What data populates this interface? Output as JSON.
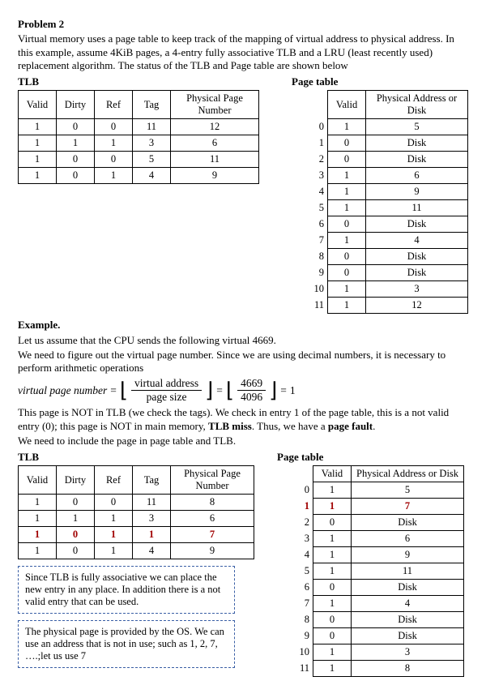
{
  "problem": {
    "title": "Problem 2",
    "intro": "Virtual memory uses a page table to keep track of the mapping of virtual address to physical address. In this example, assume 4KiB pages, a 4-entry fully associative TLB and a LRU (least recently used) replacement algorithm.  The status of the TLB and Page table are shown below"
  },
  "labels": {
    "tlb": "TLB",
    "page_table": "Page table",
    "valid": "Valid",
    "dirty": "Dirty",
    "ref": "Ref",
    "tag": "Tag",
    "ppn": "Physical Page Number",
    "paddr": "Physical Address or Disk"
  },
  "tlb1": [
    {
      "valid": "1",
      "dirty": "0",
      "ref": "0",
      "tag": "11",
      "ppn": "12"
    },
    {
      "valid": "1",
      "dirty": "1",
      "ref": "1",
      "tag": "3",
      "ppn": "6"
    },
    {
      "valid": "1",
      "dirty": "0",
      "ref": "0",
      "tag": "5",
      "ppn": "11"
    },
    {
      "valid": "1",
      "dirty": "0",
      "ref": "1",
      "tag": "4",
      "ppn": "9"
    }
  ],
  "pt1": [
    {
      "i": "0",
      "v": "1",
      "a": "5"
    },
    {
      "i": "1",
      "v": "0",
      "a": "Disk"
    },
    {
      "i": "2",
      "v": "0",
      "a": "Disk"
    },
    {
      "i": "3",
      "v": "1",
      "a": "6"
    },
    {
      "i": "4",
      "v": "1",
      "a": "9"
    },
    {
      "i": "5",
      "v": "1",
      "a": "11"
    },
    {
      "i": "6",
      "v": "0",
      "a": "Disk"
    },
    {
      "i": "7",
      "v": "1",
      "a": "4"
    },
    {
      "i": "8",
      "v": "0",
      "a": "Disk"
    },
    {
      "i": "9",
      "v": "0",
      "a": "Disk"
    },
    {
      "i": "10",
      "v": "1",
      "a": "3"
    },
    {
      "i": "11",
      "v": "1",
      "a": "12"
    }
  ],
  "example": {
    "heading": "Example.",
    "line1": "Let us assume that the CPU sends the following virtual 4669.",
    "line2": "We need to figure out the virtual page number. Since we are using decimal numbers, it is necessary to perform arithmetic operations",
    "formula_lhs": "virtual page number",
    "formula_num1": "virtual address",
    "formula_den1": "page size",
    "formula_num2": "4669",
    "formula_den2": "4096",
    "formula_result": "1",
    "line3a": "This page is NOT in TLB (we check the tags). We check in entry 1 of the page table, this is a not valid entry (0); this page is NOT in main memory, ",
    "line3b": "TLB miss",
    "line3c": ". Thus, we have a ",
    "line3d": "page fault",
    "line3e": ".",
    "line4": "We need to include the page in page table and TLB."
  },
  "tlb2": [
    {
      "valid": "1",
      "dirty": "0",
      "ref": "0",
      "tag": "11",
      "ppn": "8"
    },
    {
      "valid": "1",
      "dirty": "1",
      "ref": "1",
      "tag": "3",
      "ppn": "6"
    },
    {
      "valid": "1",
      "dirty": "0",
      "ref": "1",
      "tag": "1",
      "ppn": "7",
      "hl": true
    },
    {
      "valid": "1",
      "dirty": "0",
      "ref": "1",
      "tag": "4",
      "ppn": "9"
    }
  ],
  "pt2": [
    {
      "i": "0",
      "v": "1",
      "a": "5"
    },
    {
      "i": "1",
      "v": "1",
      "a": "7",
      "hl": true
    },
    {
      "i": "2",
      "v": "0",
      "a": "Disk"
    },
    {
      "i": "3",
      "v": "1",
      "a": "6"
    },
    {
      "i": "4",
      "v": "1",
      "a": "9"
    },
    {
      "i": "5",
      "v": "1",
      "a": "11"
    },
    {
      "i": "6",
      "v": "0",
      "a": "Disk"
    },
    {
      "i": "7",
      "v": "1",
      "a": "4"
    },
    {
      "i": "8",
      "v": "0",
      "a": "Disk"
    },
    {
      "i": "9",
      "v": "0",
      "a": "Disk"
    },
    {
      "i": "10",
      "v": "1",
      "a": "3"
    },
    {
      "i": "11",
      "v": "1",
      "a": "8"
    }
  ],
  "notes": {
    "box1": "Since TLB is fully associative we can place the new entry in any place. In addition there is a not valid entry that can be used.",
    "box2": "The physical page is provided by the OS. We can use an address that is not in use; such as 1, 2, 7, ….;let us use 7"
  }
}
